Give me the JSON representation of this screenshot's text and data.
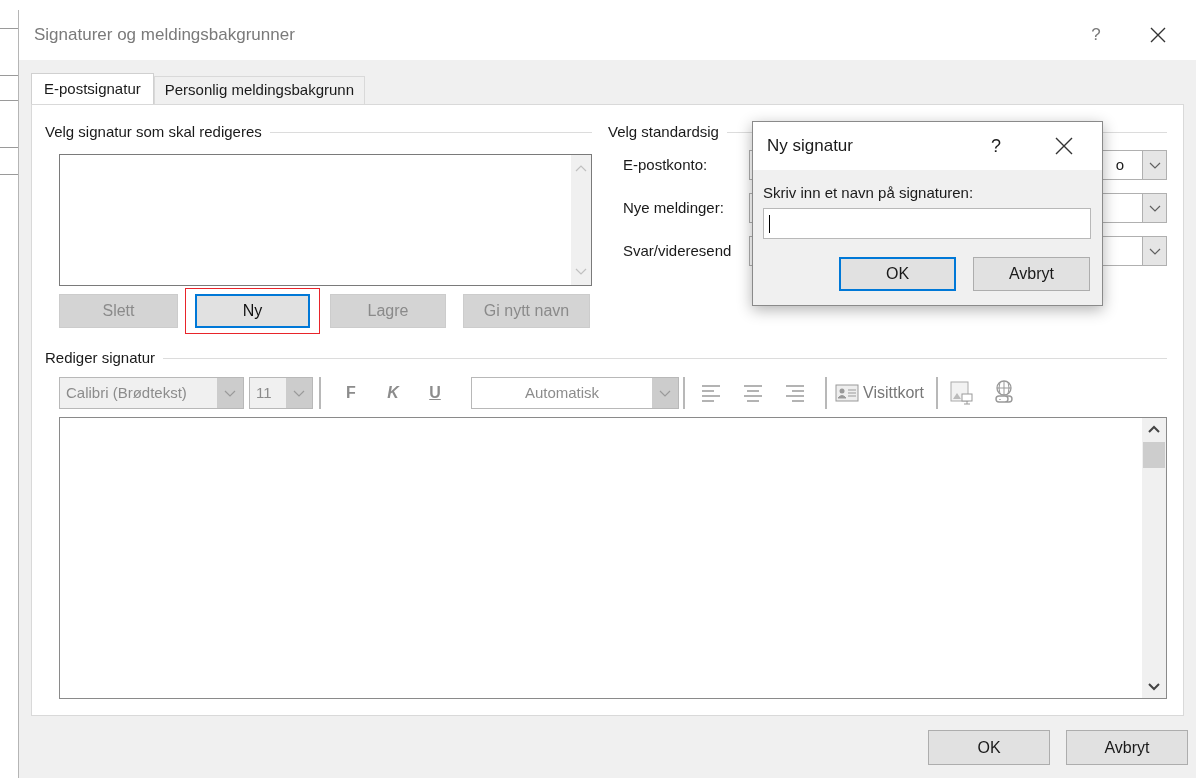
{
  "window": {
    "title": "Signaturer og meldingsbakgrunner",
    "help": "?"
  },
  "tabs": [
    {
      "label": "E-postsignatur",
      "selected": true
    },
    {
      "label": "Personlig meldingsbakgrunn",
      "selected": false
    }
  ],
  "select_signature": {
    "heading": "Velg signatur som skal redigeres",
    "buttons": [
      {
        "label": "Slett",
        "disabled": true,
        "focused": false,
        "highlighted": false
      },
      {
        "label": "Ny",
        "disabled": false,
        "focused": true,
        "highlighted": true
      },
      {
        "label": "Lagre",
        "disabled": true,
        "focused": false,
        "highlighted": false
      },
      {
        "label": "Gi nytt navn",
        "disabled": true,
        "focused": false,
        "highlighted": false
      }
    ]
  },
  "default_signature": {
    "heading": "Velg standardsig",
    "rows": [
      {
        "label": "E-postkonto:",
        "value": "o"
      },
      {
        "label": "Nye meldinger:"
      },
      {
        "label": "Svar/videresend"
      }
    ]
  },
  "edit_signature": {
    "heading": "Rediger signatur",
    "font": "Calibri (Brødtekst)",
    "size": "11",
    "format_buttons": [
      {
        "label": "F",
        "kind": "bold"
      },
      {
        "label": "K",
        "kind": "italic"
      },
      {
        "label": "U",
        "kind": "underline"
      }
    ],
    "color_choice": "Automatisk",
    "business_card": "Visittkort"
  },
  "buttons": [
    {
      "label": "OK"
    },
    {
      "label": "Avbryt"
    }
  ],
  "dialog": {
    "title": "Ny signatur",
    "help": "?",
    "prompt": "Skriv inn et navn på signaturen:",
    "buttons": [
      {
        "label": "OK",
        "default": true
      },
      {
        "label": "Avbryt",
        "default": false
      }
    ]
  }
}
